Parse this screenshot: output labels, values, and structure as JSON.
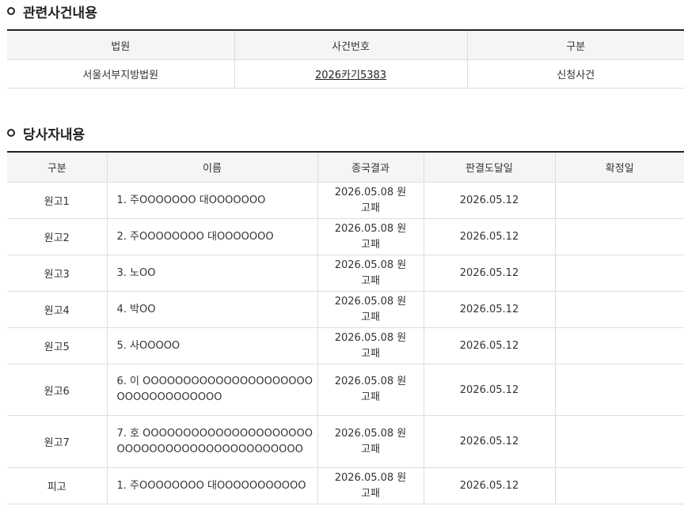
{
  "related_section": {
    "title": "관련사건내용",
    "headers": [
      "법원",
      "사건번호",
      "구분"
    ],
    "rows": [
      {
        "court": "서울서부지방법원",
        "case_number": "2026카기5383",
        "type": "신청사건"
      }
    ]
  },
  "party_section": {
    "title": "당사자내용",
    "headers": [
      "구분",
      "이름",
      "종국결과",
      "판결도달일",
      "확정일"
    ],
    "rows": [
      {
        "role": "원고1",
        "name": "1. 주OOOOOOO 대OOOOOOO",
        "result": "2026.05.08 원고패",
        "delivered": "2026.05.12",
        "finalized": ""
      },
      {
        "role": "원고2",
        "name": "2. 주OOOOOOOO 대OOOOOOO",
        "result": "2026.05.08 원고패",
        "delivered": "2026.05.12",
        "finalized": ""
      },
      {
        "role": "원고3",
        "name": "3. 노OO",
        "result": "2026.05.08 원고패",
        "delivered": "2026.05.12",
        "finalized": ""
      },
      {
        "role": "원고4",
        "name": "4. 박OO",
        "result": "2026.05.08 원고패",
        "delivered": "2026.05.12",
        "finalized": ""
      },
      {
        "role": "원고5",
        "name": "5. 사OOOOO",
        "result": "2026.05.08 원고패",
        "delivered": "2026.05.12",
        "finalized": ""
      },
      {
        "role": "원고6",
        "name": "6. 이 OOOOOOOOOOOOOOOOOOOOOOOOOOOOOOOOOO",
        "result": "2026.05.08 원고패",
        "delivered": "2026.05.12",
        "finalized": ""
      },
      {
        "role": "원고7",
        "name": "7. 호 OOOOOOOOOOOOOOOOOOOOOOOOOOOOOOOOOOOOOOOOOOOO",
        "result": "2026.05.08 원고패",
        "delivered": "2026.05.12",
        "finalized": ""
      },
      {
        "role": "피고",
        "name": "1. 주OOOOOOOO 대OOOOOOOOOOO",
        "result": "2026.05.08 원고패",
        "delivered": "2026.05.12",
        "finalized": ""
      }
    ]
  }
}
